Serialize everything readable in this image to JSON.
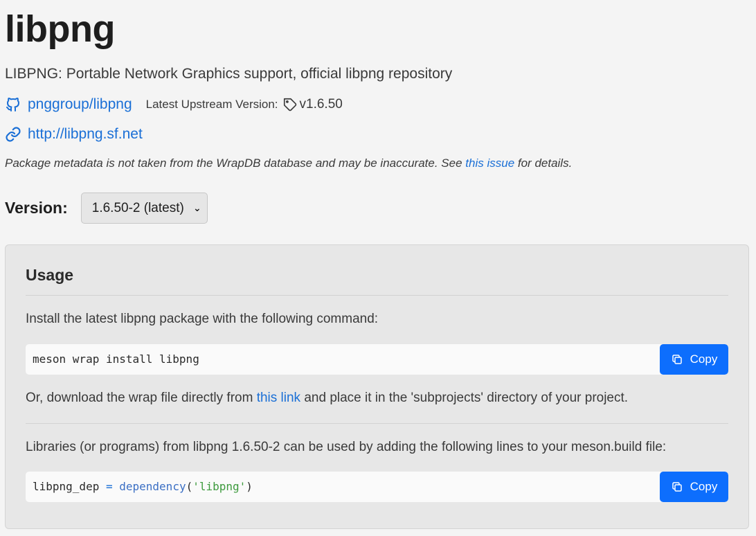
{
  "package": {
    "name": "libpng",
    "description": "LIBPNG: Portable Network Graphics support, official libpng repository",
    "repo_label": "pnggroup/libpng",
    "upstream_label": "Latest Upstream Version:",
    "upstream_version": "v1.6.50",
    "homepage_label": "http://libpng.sf.net"
  },
  "note": {
    "before": "Package metadata is not taken from the WrapDB database and may be inaccurate. See ",
    "link": "this issue",
    "after": " for details."
  },
  "version": {
    "label": "Version:",
    "selected": "1.6.50-2 (latest)"
  },
  "usage": {
    "title": "Usage",
    "install_text": "Install the latest libpng package with the following command:",
    "install_command": "meson wrap install libpng",
    "copy_label": "Copy",
    "download_before": "Or, download the wrap file directly from ",
    "download_link": "this link",
    "download_after": " and place it in the 'subprojects' directory of your project.",
    "libraries_text": "Libraries (or programs) from libpng 1.6.50-2 can be used by adding the following lines to your meson.build file:",
    "code": {
      "var": "libpng_dep",
      "op": "=",
      "fn": "dependency",
      "open": "(",
      "arg": "'libpng'",
      "close": ")"
    }
  },
  "colors": {
    "link": "#1a6fd6",
    "button": "#0d6efd",
    "string": "#3d9a3d"
  },
  "icons": {
    "repo": "github-icon",
    "homepage": "link-icon",
    "version_tag": "tag-icon",
    "copy": "copy-icon"
  }
}
